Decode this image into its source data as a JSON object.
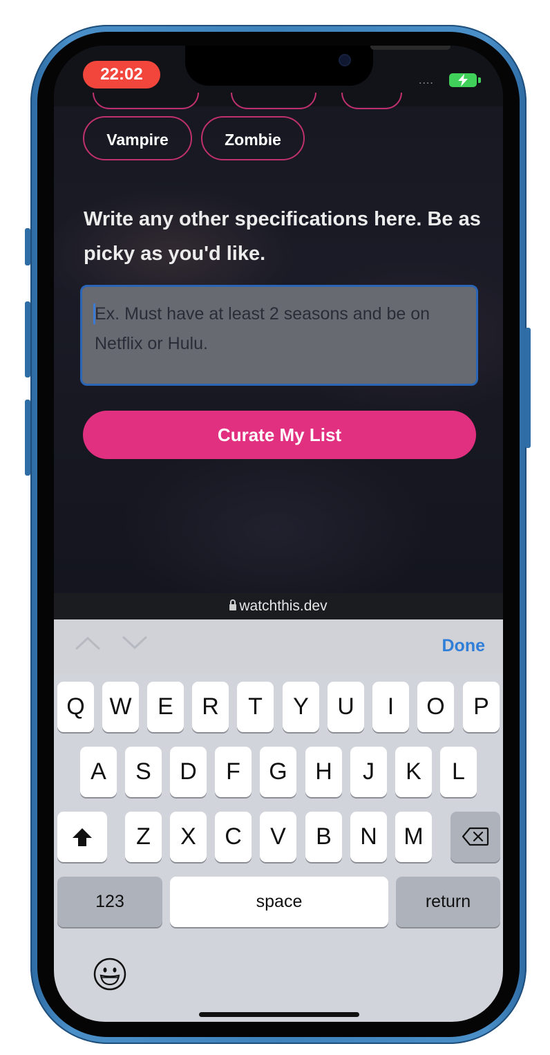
{
  "status_bar": {
    "time": "22:02",
    "signal": "....",
    "battery": "charging"
  },
  "tags": {
    "visible": [
      "Vampire",
      "Zombie"
    ]
  },
  "prompt": "Write any other specifications here. Be as picky as you'd like.",
  "specs_input": {
    "value": "",
    "placeholder": "Ex. Must have at least 2 seasons and be on Netflix or Hulu."
  },
  "cta_label": "Curate My List",
  "url": "watchthis.dev",
  "keyboard_toolbar": {
    "prev_icon": "chevron-up",
    "next_icon": "chevron-down",
    "done_label": "Done"
  },
  "keyboard": {
    "row1": [
      "Q",
      "W",
      "E",
      "R",
      "T",
      "Y",
      "U",
      "I",
      "O",
      "P"
    ],
    "row2": [
      "A",
      "S",
      "D",
      "F",
      "G",
      "H",
      "J",
      "K",
      "L"
    ],
    "row3": [
      "Z",
      "X",
      "C",
      "V",
      "B",
      "N",
      "M"
    ],
    "numbers_label": "123",
    "space_label": "space",
    "return_label": "return",
    "shift_icon": "shift-arrow",
    "delete_icon": "backspace",
    "emoji_icon": "smiley-face"
  },
  "colors": {
    "accent_pink": "#e0307f",
    "chip_border": "#c0306e",
    "link_blue": "#2f7ed8",
    "time_pill": "#f2463c"
  }
}
